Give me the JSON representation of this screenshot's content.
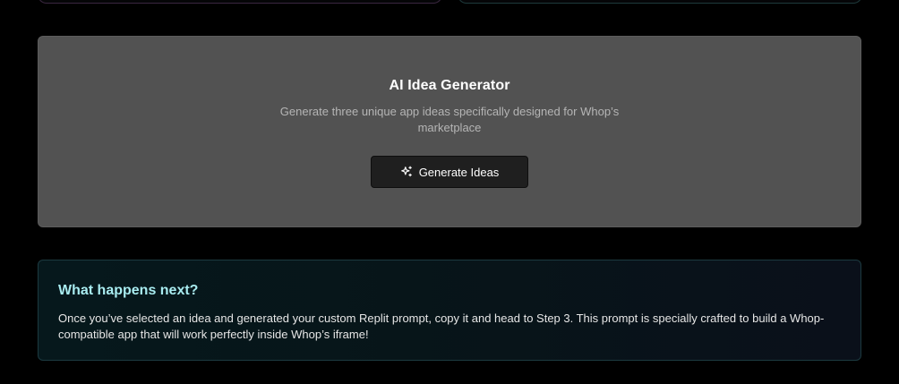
{
  "generator": {
    "title": "AI Idea Generator",
    "description": "Generate three unique app ideas specifically designed for Whop’s marketplace",
    "button_label": "Generate Ideas",
    "button_icon": "sparkles-icon"
  },
  "info": {
    "title": "What happens next?",
    "body": "Once you’ve selected an idea and generated your custom Replit prompt, copy it and head to Step 3. This prompt is specially crafted to build a Whop-compatible app that will work perfectly inside Whop’s iframe!"
  },
  "colors": {
    "page_background": "#000000",
    "generator_card": "#525252",
    "button_background": "#1f1f1f",
    "info_title": "#a8ecf0"
  }
}
